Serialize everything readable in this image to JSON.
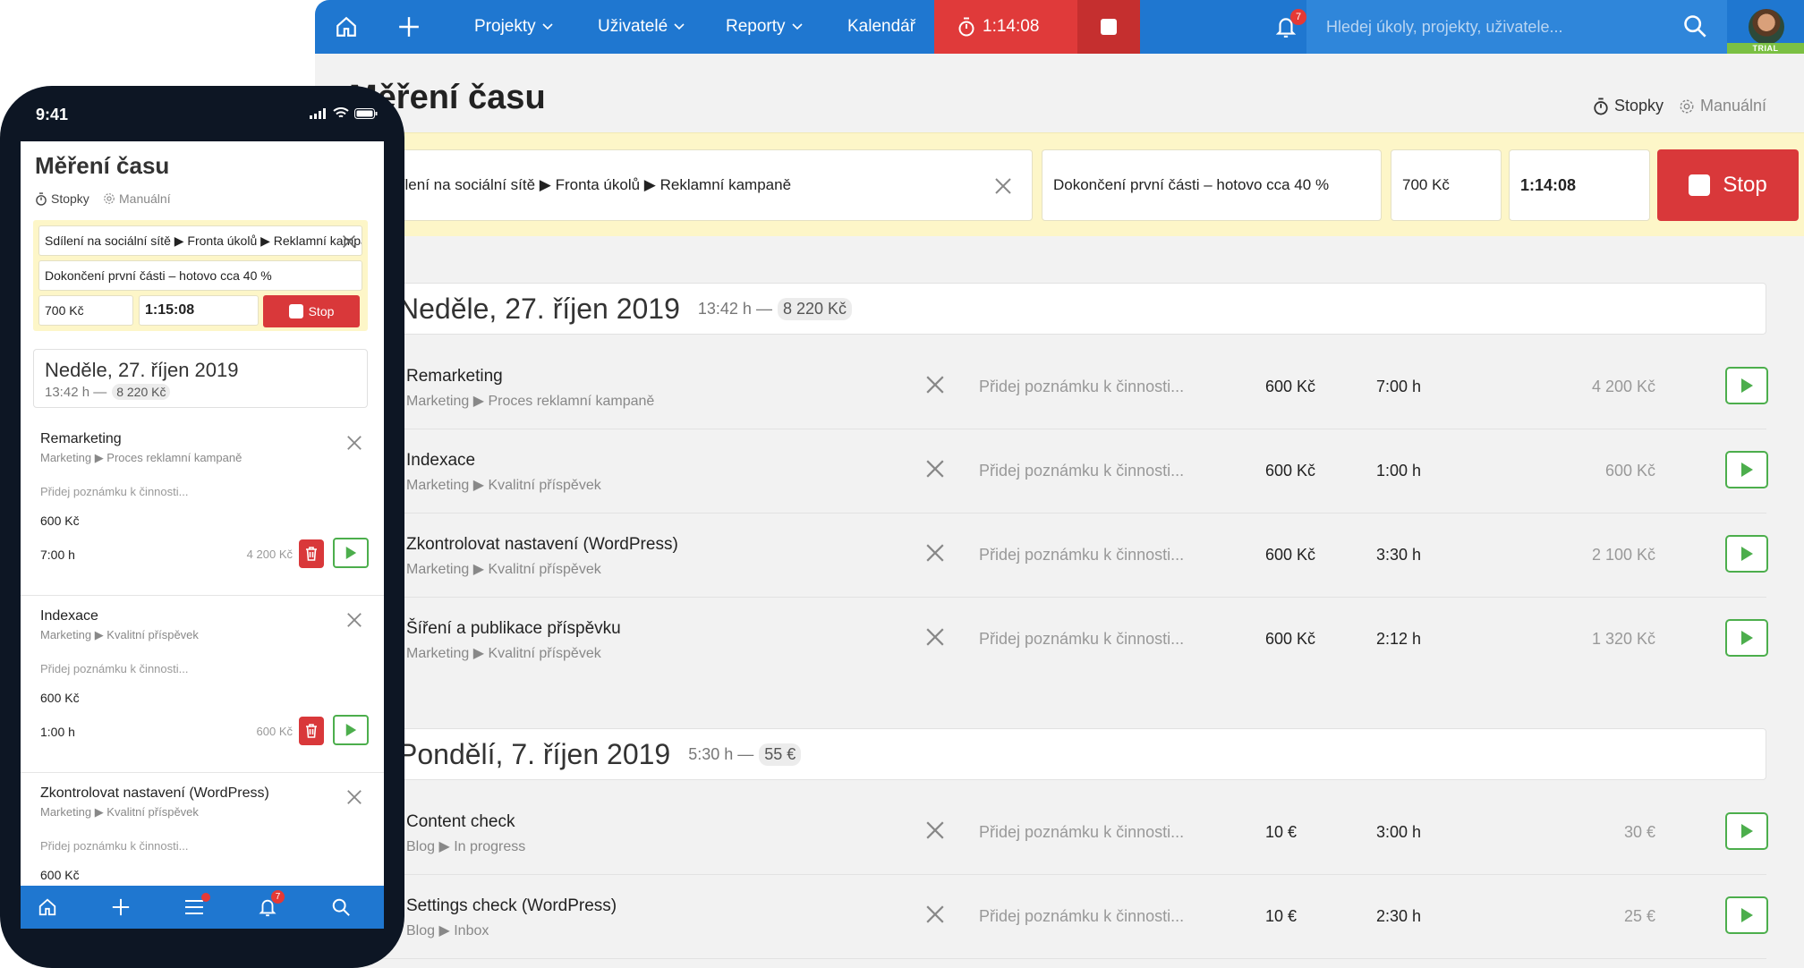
{
  "desktop": {
    "nav": {
      "projects_label": "Projekty",
      "users_label": "Uživatelé",
      "reports_label": "Reporty",
      "calendar_label": "Kalendář",
      "timer_value": "1:14:08",
      "notifications_count": "7",
      "search_placeholder": "Hledej úkoly, projekty, uživatele...",
      "trial_label": "TRIAL"
    },
    "page_title": "Měření času",
    "modes": {
      "stopwatch": "Stopky",
      "manual": "Manuální"
    },
    "tracker": {
      "task_path": "Sdílení na sociální sítě ▶ Fronta úkolů ▶ Reklamní kampaně",
      "note": "Dokončení první části – hotovo cca 40 %",
      "rate": "700 Kč",
      "time": "1:14:08",
      "stop_label": "Stop"
    },
    "days": [
      {
        "title": "Neděle, 27. říjen 2019",
        "hours": "13:42 h —",
        "amount": "8 220 Kč",
        "rows": [
          {
            "title": "Remarketing",
            "path": "Marketing ▶ Proces reklamní kampaně",
            "note_placeholder": "Přidej poznámku k činnosti...",
            "rate": "600 Kč",
            "hours": "7:00 h",
            "total": "4 200 Kč"
          },
          {
            "title": "Indexace",
            "path": "Marketing ▶ Kvalitní příspěvek",
            "note_placeholder": "Přidej poznámku k činnosti...",
            "rate": "600 Kč",
            "hours": "1:00 h",
            "total": "600 Kč"
          },
          {
            "title": "Zkontrolovat nastavení (WordPress)",
            "path": "Marketing ▶ Kvalitní příspěvek",
            "note_placeholder": "Přidej poznámku k činnosti...",
            "rate": "600 Kč",
            "hours": "3:30 h",
            "total": "2 100 Kč"
          },
          {
            "title": "Šíření a publikace příspěvku",
            "path": "Marketing ▶ Kvalitní příspěvek",
            "note_placeholder": "Přidej poznámku k činnosti...",
            "rate": "600 Kč",
            "hours": "2:12 h",
            "total": "1 320 Kč"
          }
        ]
      },
      {
        "title": "Pondělí, 7. říjen 2019",
        "hours": "5:30 h —",
        "amount": "55 €",
        "rows": [
          {
            "title": "Content check",
            "path": "Blog ▶ In progress",
            "note_placeholder": "Přidej poznámku k činnosti...",
            "rate": "10 €",
            "hours": "3:00 h",
            "total": "30 €"
          },
          {
            "title": "Settings check (WordPress)",
            "path": "Blog ▶ Inbox",
            "note_placeholder": "Přidej poznámku k činnosti...",
            "rate": "10 €",
            "hours": "2:30 h",
            "total": "25 €"
          }
        ]
      }
    ]
  },
  "phone": {
    "status_time": "9:41",
    "title": "Měření času",
    "modes": {
      "stopwatch": "Stopky",
      "manual": "Manuální"
    },
    "tracker": {
      "task_path": "Sdílení na sociální sítě ▶ Fronta úkolů ▶ Reklamní kampaně",
      "note": "Dokončení první části – hotovo cca 40 %",
      "rate": "700 Kč",
      "time": "1:15:08",
      "stop_label": "Stop"
    },
    "day": {
      "title": "Neděle, 27. říjen 2019",
      "hours": "13:42 h —",
      "amount": "8 220 Kč"
    },
    "items": [
      {
        "title": "Remarketing",
        "path": "Marketing ▶ Proces reklamní kampaně",
        "note_placeholder": "Přidej poznámku k činnosti...",
        "rate": "600 Kč",
        "hours": "7:00 h",
        "total": "4 200 Kč"
      },
      {
        "title": "Indexace",
        "path": "Marketing ▶ Kvalitní příspěvek",
        "note_placeholder": "Přidej poznámku k činnosti...",
        "rate": "600 Kč",
        "hours": "1:00 h",
        "total": "600 Kč"
      },
      {
        "title": "Zkontrolovat nastavení (WordPress)",
        "path": "Marketing ▶ Kvalitní příspěvek",
        "note_placeholder": "Přidej poznámku k činnosti...",
        "rate": "600 Kč"
      }
    ],
    "notifications_count": "7"
  },
  "colors": {
    "brand_blue": "#1f77d0",
    "stop_red": "#d9383a",
    "play_green": "#4cae4c",
    "tracker_yellow": "#fdf6c8"
  },
  "icons": [
    "home-icon",
    "plus-icon",
    "chevron-down-icon",
    "stopwatch-icon",
    "stop-icon",
    "bell-icon",
    "search-icon",
    "close-icon",
    "play-icon",
    "trash-icon",
    "gear-icon",
    "menu-icon"
  ]
}
